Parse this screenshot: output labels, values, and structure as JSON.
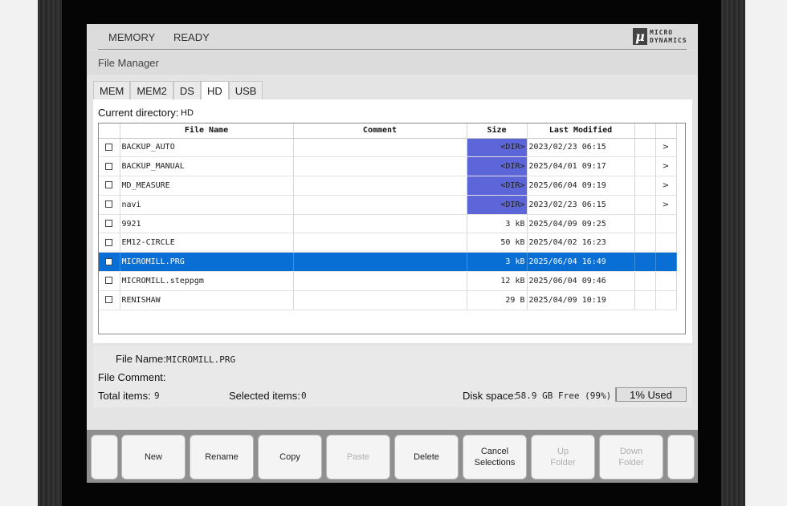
{
  "status": {
    "memory": "MEMORY",
    "ready": "READY"
  },
  "logo": {
    "mark": "μ",
    "line1": "MICRO",
    "line2": "DYNAMICS"
  },
  "title": "File Manager",
  "tabs": [
    "MEM",
    "MEM2",
    "DS",
    "HD",
    "USB"
  ],
  "active_tab": "HD",
  "current_directory": {
    "label": "Current directory:",
    "value": "HD"
  },
  "columns": {
    "name": "File Name",
    "comment": "Comment",
    "size": "Size",
    "modified": "Last Modified"
  },
  "files": [
    {
      "name": "BACKUP_AUTO",
      "comment": "",
      "size": "<DIR>",
      "modified": "2023/02/23 06:15",
      "arrow": ">"
    },
    {
      "name": "BACKUP_MANUAL",
      "comment": "",
      "size": "<DIR>",
      "modified": "2025/04/01 09:17",
      "arrow": ">"
    },
    {
      "name": "MD_MEASURE",
      "comment": "",
      "size": "<DIR>",
      "modified": "2025/06/04 09:19",
      "arrow": ">"
    },
    {
      "name": "navi",
      "comment": "",
      "size": "<DIR>",
      "modified": "2023/02/23 06:15",
      "arrow": ">"
    },
    {
      "name": "9921",
      "comment": "",
      "size": "3 kB",
      "modified": "2025/04/09 09:25",
      "arrow": ""
    },
    {
      "name": "EM12-CIRCLE",
      "comment": "",
      "size": "50 kB",
      "modified": "2025/04/02 16:23",
      "arrow": ""
    },
    {
      "name": "MICROMILL.PRG",
      "comment": "",
      "size": "3 kB",
      "modified": "2025/06/04 16:49",
      "arrow": ""
    },
    {
      "name": "MICROMILL.steppgm",
      "comment": "",
      "size": "12 kB",
      "modified": "2025/06/04 09:46",
      "arrow": ""
    },
    {
      "name": "RENISHAW",
      "comment": "",
      "size": "29 B",
      "modified": "2025/04/09 10:19",
      "arrow": ""
    }
  ],
  "selected_index": 6,
  "colors": {
    "selection": "#0a6fd5",
    "dir_highlight": "#5c66d8",
    "usage_bar": "#3bb34a"
  },
  "info": {
    "file_name_label": "File Name:",
    "file_name_value": "MICROMILL.PRG",
    "file_comment_label": "File Comment:",
    "total_label": "Total items:",
    "total_value": "9",
    "selected_label": "Selected items:",
    "selected_value": "0",
    "disk_label": "Disk space:",
    "disk_value": "58.9 GB Free (99%)",
    "used_label": "1% Used",
    "used_fraction": 0.01
  },
  "softkeys": [
    {
      "label": "",
      "enabled": true
    },
    {
      "label": "New",
      "enabled": true
    },
    {
      "label": "Rename",
      "enabled": true
    },
    {
      "label": "Copy",
      "enabled": true
    },
    {
      "label": "Paste",
      "enabled": false
    },
    {
      "label": "Delete",
      "enabled": true
    },
    {
      "label": "Cancel\nSelections",
      "enabled": true
    },
    {
      "label": "Up\nFolder",
      "enabled": false
    },
    {
      "label": "Down\nFolder",
      "enabled": false
    },
    {
      "label": "",
      "enabled": true
    }
  ]
}
